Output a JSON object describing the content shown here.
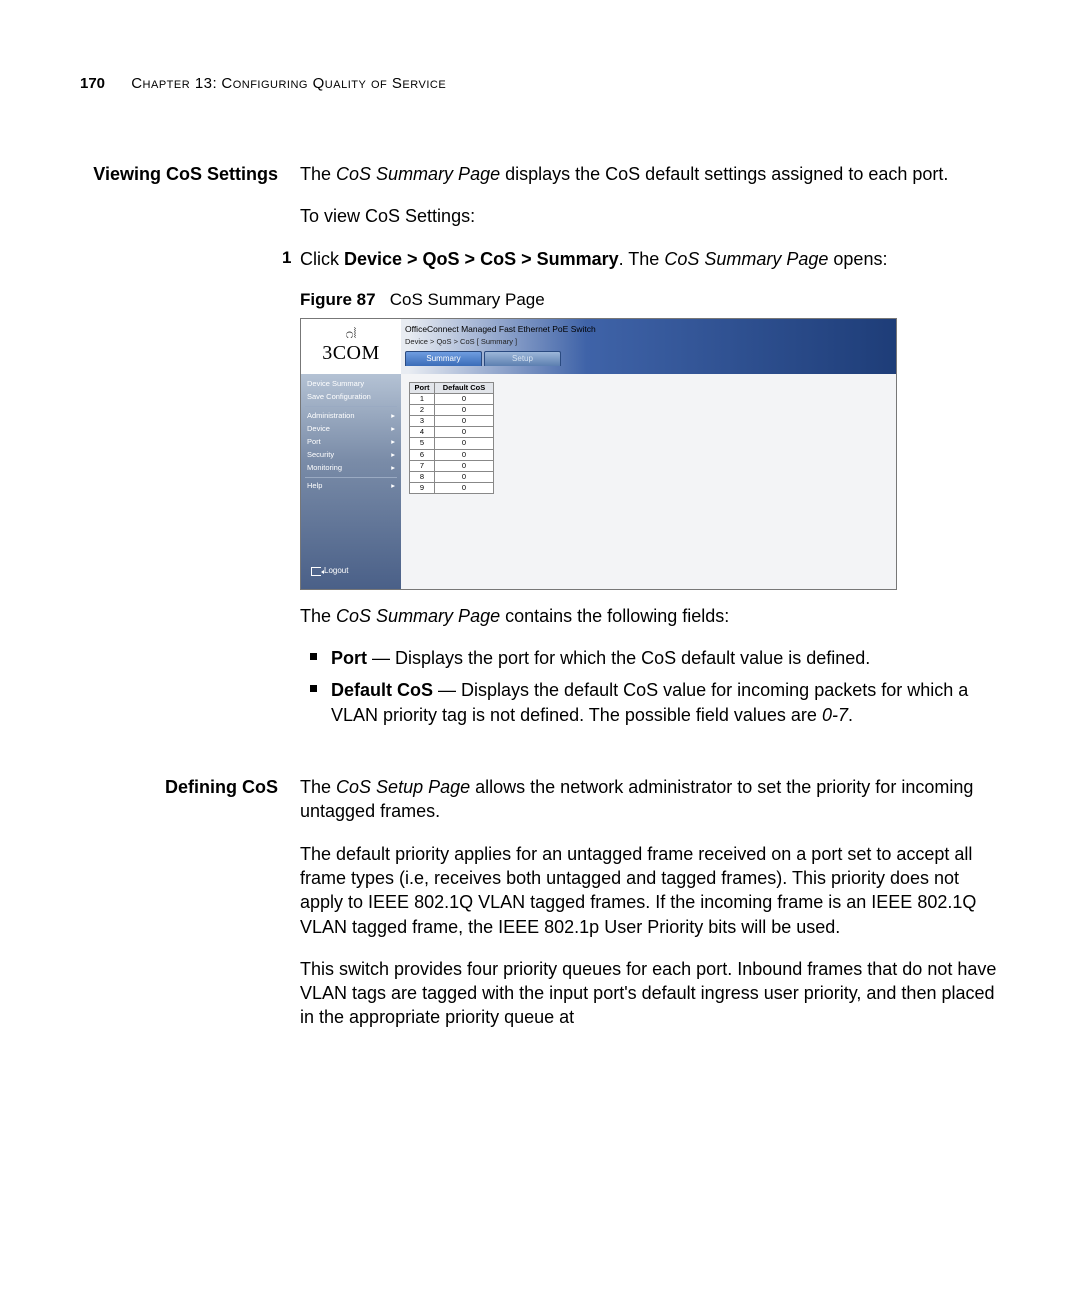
{
  "header": {
    "page_number": "170",
    "chapter_label": "Chapter 13:",
    "chapter_title": "Configuring Quality of Service"
  },
  "section1": {
    "heading": "Viewing CoS Settings",
    "intro_pre": "The ",
    "intro_em": "CoS Summary Page",
    "intro_post": " displays the CoS default settings assigned to each port.",
    "instruction": "To view CoS Settings:",
    "step_num": "1",
    "step_pre": "Click ",
    "step_path": "Device > QoS > CoS > Summary",
    "step_mid": ". The ",
    "step_em": "CoS Summary Page",
    "step_post": " opens:"
  },
  "figure": {
    "label": "Figure 87",
    "caption": "CoS Summary Page"
  },
  "screenshot": {
    "logo": "3COM",
    "title": "OfficeConnect Managed Fast Ethernet PoE Switch",
    "breadcrumb": "Device > QoS > CoS [ Summary ]",
    "tab_active": "Summary",
    "tab_inactive": "Setup",
    "sidebar": {
      "i0": "Device Summary",
      "i1": "Save Configuration",
      "i2": "Administration",
      "i3": "Device",
      "i4": "Port",
      "i5": "Security",
      "i6": "Monitoring",
      "i7": "Help",
      "logout": "Logout"
    },
    "table": {
      "h1": "Port",
      "h2": "Default CoS",
      "ports": [
        "1",
        "2",
        "3",
        "4",
        "5",
        "6",
        "7",
        "8",
        "9"
      ],
      "cos": [
        "0",
        "0",
        "0",
        "0",
        "0",
        "0",
        "0",
        "0",
        "0"
      ]
    }
  },
  "fields_intro_pre": "The ",
  "fields_intro_em": "CoS Summary Page",
  "fields_intro_post": " contains the following fields:",
  "bullets": {
    "b1_label": "Port",
    "b1_text": " — Displays the port for which the CoS default value is defined.",
    "b2_label": "Default CoS",
    "b2_text_pre": " — Displays the default CoS value for incoming packets for which a VLAN priority tag is not defined. The possible field values are ",
    "b2_em": "0-7",
    "b2_text_post": "."
  },
  "section2": {
    "heading": "Defining CoS",
    "p1_pre": "The ",
    "p1_em": "CoS Setup Page",
    "p1_post": " allows the network administrator to set the priority for incoming untagged frames.",
    "p2": "The default priority applies for an untagged frame received on a port set to accept all frame types (i.e, receives both untagged and tagged frames). This priority does not apply to IEEE 802.1Q VLAN tagged frames. If the incoming frame is an IEEE 802.1Q VLAN tagged frame, the IEEE 802.1p User Priority bits will be used.",
    "p3": "This switch provides four priority queues for each port. Inbound frames that do not have VLAN tags are tagged with the input port's default ingress user priority, and then placed in the appropriate priority queue at"
  }
}
